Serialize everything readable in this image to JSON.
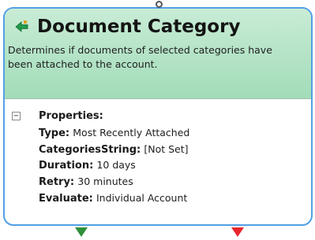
{
  "node": {
    "title": "Document Category",
    "description": "Determines if documents of selected categories have been attached to the account.",
    "header_icon": "green-arrow-icon",
    "colors": {
      "border": "#52a0e4",
      "header_background": "#b3e3c6",
      "success_connector": "#2f8f3a",
      "failure_connector": "#e8262c"
    }
  },
  "properties": {
    "toggle_glyph": "⊟",
    "heading": "Properties:",
    "items": [
      {
        "key": "Type:",
        "value": "Most Recently Attached"
      },
      {
        "key": "CategoriesString:",
        "value": "[Not Set]"
      },
      {
        "key": "Duration:",
        "value": "10 days"
      },
      {
        "key": "Retry:",
        "value": "30 minutes"
      },
      {
        "key": "Evaluate:",
        "value": "Individual Account"
      }
    ]
  }
}
